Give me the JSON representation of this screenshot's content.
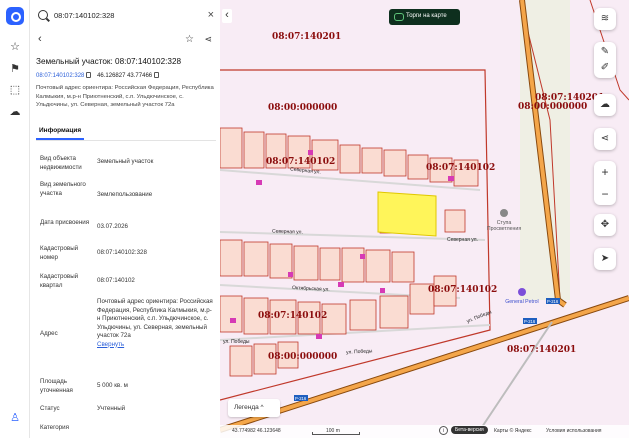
{
  "search": {
    "value": "08:07:140102:328"
  },
  "object": {
    "title": "Земельный участок: 08:07:140102:328",
    "cad_number": "08:07:140102:328",
    "coords": "46.126827 43.77466",
    "address": "Почтовый адрес ориентира: Российская Федерация, Республика Калмыкия, м.р-н Приютненский, с.п. Ульдючинское, с. Ульдючины, ул. Северная, земельный участок 72а"
  },
  "tabs": [
    {
      "label": "Информация"
    }
  ],
  "info_rows": [
    {
      "key": "Вид объекта недвижимости",
      "value": "Земельный участок"
    },
    {
      "key": "Вид земельного участка",
      "value": "Землепользование"
    },
    {
      "key": "Дата присвоения",
      "value": "03.07.2026"
    },
    {
      "key": "Кадастровый номер",
      "value": "08:07:140102:328"
    },
    {
      "key": "Кадастровый квартал",
      "value": "08:07:140102"
    },
    {
      "key": "Адрес",
      "value": "Почтовый адрес ориентира: Российская Федерация, Республика Калмыкия, м.р-н Приютненский, с.п. Ульдючинское, с. Ульдючины, ул. Северная, земельный участок 72а",
      "link": "Свернуть"
    },
    {
      "key": "Площадь уточненная",
      "value": "5 000 кв. м"
    },
    {
      "key": "Статус",
      "value": "Учтенный"
    },
    {
      "key": "Категория",
      "value": ""
    }
  ],
  "map": {
    "torgi_label": "Торги на карте",
    "legend_label": "Легенда",
    "legend_chevron": "^",
    "cadastral_labels": [
      "08:07:140201",
      "08:00:000000",
      "08:07:140201",
      "08:00:000000",
      "08:07:140102",
      "08:07:140102",
      "08:07:140102",
      "08:07:140102",
      "08:00:000000",
      "08:07:140201"
    ],
    "streets": [
      "Северная ул.",
      "Северная ул.",
      "Северная ул.",
      "Октябрьская ул.",
      "ул. Победы",
      "ул. Победы",
      "ул. Победы",
      "Р-216",
      "Р-216",
      "Р-216"
    ],
    "pois": {
      "school": "Ступа Просветления",
      "fuel": "General Petrol"
    },
    "bottom": {
      "coords": "43.774982   46.123648",
      "scale": "100 m",
      "beta": "Бета-версия",
      "copyright": "Карты © Яндекс",
      "terms": "Условия использования"
    },
    "colors": {
      "parcel_border": "#c0392b",
      "parcel_fill": "#fadcd2",
      "highlight": "#fff55a",
      "road": "#f4a64a",
      "cad_label": "#8b0d0d"
    }
  }
}
